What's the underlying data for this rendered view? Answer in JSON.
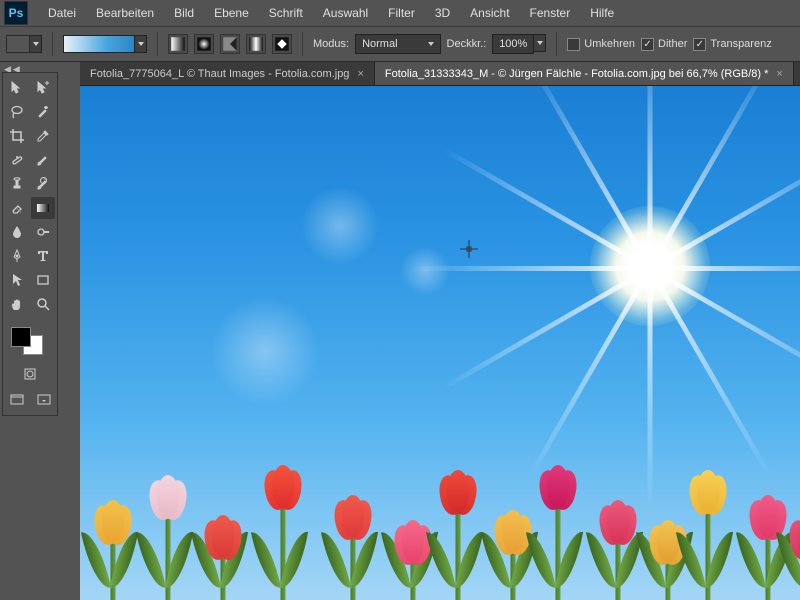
{
  "app": {
    "logo": "Ps"
  },
  "menu": [
    "Datei",
    "Bearbeiten",
    "Bild",
    "Ebene",
    "Schrift",
    "Auswahl",
    "Filter",
    "3D",
    "Ansicht",
    "Fenster",
    "Hilfe"
  ],
  "options": {
    "modus_label": "Modus:",
    "modus_value": "Normal",
    "deckkraft_label": "Deckkr.:",
    "deckkraft_value": "100%",
    "umkehren_label": "Umkehren",
    "umkehren_checked": false,
    "dither_label": "Dither",
    "dither_checked": true,
    "transparenz_label": "Transparenz",
    "transparenz_checked": true
  },
  "tabs": [
    {
      "title": "Fotolia_7775064_L © Thaut Images - Fotolia.com.jpg",
      "active": false
    },
    {
      "title": "Fotolia_31333343_M - © Jürgen Fälchle - Fotolia.com.jpg bei 66,7% (RGB/8) *",
      "active": true
    }
  ],
  "tools": {
    "row1": [
      "move-tool",
      "artboard-tool"
    ],
    "row2": [
      "lasso-tool",
      "magic-wand-tool"
    ],
    "row3": [
      "crop-tool",
      "eyedropper-tool"
    ],
    "row4": [
      "healing-brush-tool",
      "brush-tool"
    ],
    "row5": [
      "clone-stamp-tool",
      "history-brush-tool"
    ],
    "row6": [
      "eraser-tool",
      "gradient-tool"
    ],
    "row7": [
      "blur-tool",
      "dodge-tool"
    ],
    "row8": [
      "pen-tool",
      "type-tool"
    ],
    "row9": [
      "path-select-tool",
      "rectangle-tool"
    ],
    "row10": [
      "hand-tool",
      "zoom-tool"
    ],
    "selected": "gradient-tool"
  },
  "colors": {
    "fg": "#000000",
    "bg": "#ffffff"
  }
}
